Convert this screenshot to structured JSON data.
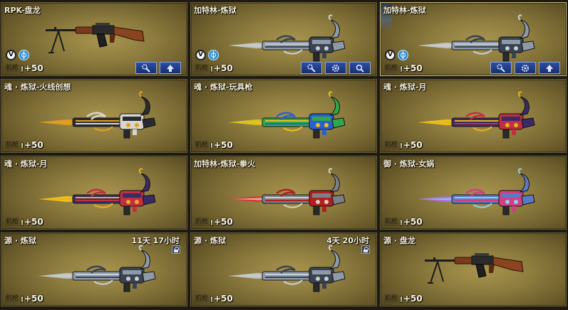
{
  "cards": [
    {
      "name": "RPK-盘龙",
      "category": "机枪",
      "ammo": "+50",
      "weapon": "rpk",
      "badges": true,
      "buttons": [
        "upgrade-icon",
        "arrow-up-icon"
      ]
    },
    {
      "name": "加特林-炼狱",
      "category": "机枪",
      "ammo": "+50",
      "weapon": "gatling",
      "palette": "steel",
      "badges": true,
      "buttons": [
        "upgrade-icon",
        "gear-icon",
        "magnify-icon"
      ]
    },
    {
      "name": "加特林-炼狱",
      "category": "机枪",
      "ammo": "+50",
      "weapon": "gatling",
      "palette": "steel",
      "badges": true,
      "selected": true,
      "buttons": [
        "upgrade-icon",
        "gear-icon",
        "arrow-up-icon"
      ]
    },
    {
      "name": "魂 · 炼狱-火线创想",
      "category": "机枪",
      "ammo": "+50",
      "weapon": "gatling",
      "palette": "fire"
    },
    {
      "name": "魂 · 炼狱-玩具枪",
      "category": "机枪",
      "ammo": "+50",
      "weapon": "gatling",
      "palette": "toy"
    },
    {
      "name": "魂 · 炼狱-月",
      "category": "机枪",
      "ammo": "+50",
      "weapon": "gatling",
      "palette": "moon"
    },
    {
      "name": "魂 · 炼狱-月",
      "category": "机枪",
      "ammo": "+50",
      "weapon": "gatling",
      "palette": "moon"
    },
    {
      "name": "加特林-炼狱-拳火",
      "category": "机枪",
      "ammo": "+50",
      "weapon": "gatling",
      "palette": "red"
    },
    {
      "name": "御 · 炼狱-女娲",
      "category": "机枪",
      "ammo": "+50",
      "weapon": "gatling",
      "palette": "nuwa"
    },
    {
      "name": "源 · 炼狱",
      "category": "机枪",
      "ammo": "+50",
      "weapon": "gatling",
      "palette": "steel",
      "timer": "11天 17小时",
      "locked": true
    },
    {
      "name": "源 · 炼狱",
      "category": "机枪",
      "ammo": "+50",
      "weapon": "gatling",
      "palette": "steel",
      "timer": "4天 20小时",
      "locked": true
    },
    {
      "name": "源 · 盘龙",
      "category": "机枪",
      "ammo": "+50",
      "weapon": "rpk"
    }
  ],
  "palettes": {
    "steel": {
      "body": "#8e9aa8",
      "accent": "#3a4350",
      "trim": "#c7d0da",
      "flame": "#c9cfd8"
    },
    "fire": {
      "body": "#2a2a30",
      "accent": "#d9d6d0",
      "trim": "#e0a020",
      "flame": "#f0a020"
    },
    "toy": {
      "body": "#2ea84a",
      "accent": "#2b5fd0",
      "trim": "#e8c020",
      "flame": "#e0d020"
    },
    "moon": {
      "body": "#3a2a6a",
      "accent": "#c03040",
      "trim": "#e8b020",
      "flame": "#ffcc10"
    },
    "red": {
      "body": "#7a7f8a",
      "accent": "#b02020",
      "trim": "#d8d0c0",
      "flame": "#e03030"
    },
    "nuwa": {
      "body": "#5a7ac8",
      "accent": "#d04080",
      "trim": "#8ad0f0",
      "flame": "#b070f0"
    }
  }
}
